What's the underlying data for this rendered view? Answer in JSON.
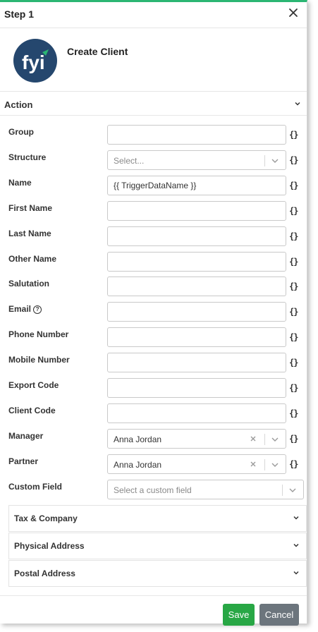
{
  "header": {
    "title": "Step 1"
  },
  "app": {
    "name": "Create Client",
    "logo_text": "fyi"
  },
  "action": {
    "label": "Action"
  },
  "fields": [
    {
      "label": "Group",
      "type": "text",
      "value": ""
    },
    {
      "label": "Structure",
      "type": "select",
      "placeholder": "Select..."
    },
    {
      "label": "Name",
      "type": "text",
      "value": "{{ TriggerDataName }}"
    },
    {
      "label": "First Name",
      "type": "text",
      "value": ""
    },
    {
      "label": "Last Name",
      "type": "text",
      "value": ""
    },
    {
      "label": "Other Name",
      "type": "text",
      "value": ""
    },
    {
      "label": "Salutation",
      "type": "text",
      "value": ""
    },
    {
      "label": "Email",
      "type": "text",
      "value": "",
      "help": "?"
    },
    {
      "label": "Phone Number",
      "type": "text",
      "value": ""
    },
    {
      "label": "Mobile Number",
      "type": "text",
      "value": ""
    },
    {
      "label": "Export Code",
      "type": "text",
      "value": ""
    },
    {
      "label": "Client Code",
      "type": "text",
      "value": ""
    },
    {
      "label": "Manager",
      "type": "select",
      "value": "Anna Jordan"
    },
    {
      "label": "Partner",
      "type": "select",
      "value": "Anna Jordan"
    },
    {
      "label": "Custom Field",
      "type": "select",
      "placeholder": "Select a custom field"
    }
  ],
  "variable_icon": "{}",
  "sections": [
    {
      "label": "Tax & Company"
    },
    {
      "label": "Physical Address"
    },
    {
      "label": "Postal Address"
    }
  ],
  "buttons": {
    "save": "Save",
    "cancel": "Cancel"
  },
  "colors": {
    "accent": "#2bb673",
    "logo_bg": "#25476e",
    "save": "#28a745",
    "cancel": "#6c757d"
  }
}
